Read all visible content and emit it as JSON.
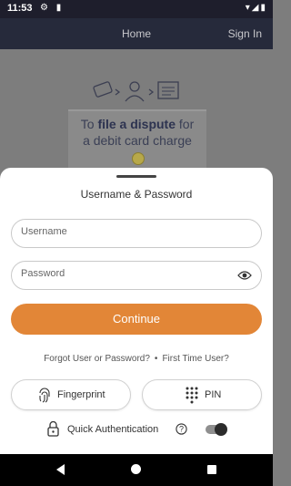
{
  "status_bar": {
    "time": "11:53",
    "left_icons": "⚙ ▮",
    "right_icons": "▾◢▮"
  },
  "header": {
    "home_label": "Home",
    "signin_label": "Sign In"
  },
  "background_promo": {
    "line1_prefix": "To ",
    "line1_bold": "file a dispute",
    "line1_suffix": " for",
    "line2": "a debit card charge"
  },
  "sheet": {
    "title": "Username & Password",
    "username_placeholder": "Username",
    "password_placeholder": "Password",
    "continue_label": "Continue",
    "forgot_link": "Forgot User or Password?",
    "separator": "•",
    "first_time_link": "First Time User?",
    "fingerprint_label": "Fingerprint",
    "pin_label": "PIN",
    "quick_auth_label": "Quick Authentication",
    "quick_auth_enabled": true
  },
  "colors": {
    "accent": "#e28637",
    "header": "#262a3b",
    "status_bar": "#1e1e2c"
  },
  "icons": [
    "gear-icon",
    "sd-card-icon",
    "wifi-icon",
    "signal-icon",
    "battery-icon",
    "eye-icon",
    "fingerprint-icon",
    "keypad-icon",
    "lock-icon",
    "help-icon",
    "back-icon",
    "home-icon",
    "recents-icon"
  ]
}
